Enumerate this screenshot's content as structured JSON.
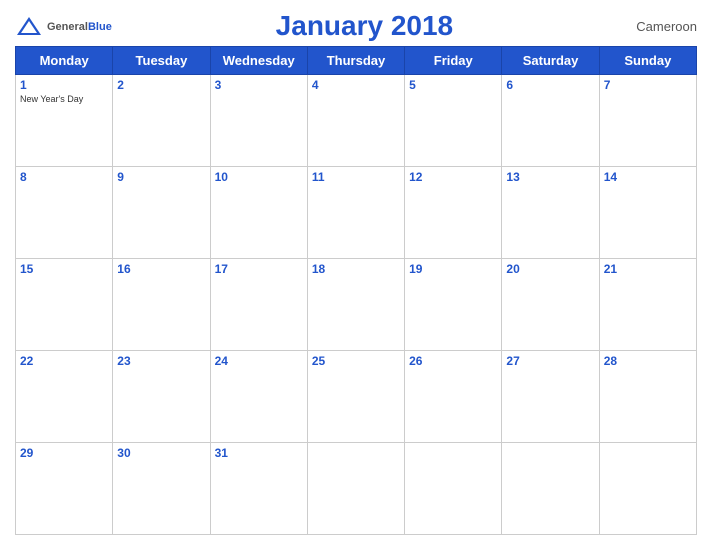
{
  "header": {
    "logo_general": "General",
    "logo_blue": "Blue",
    "title": "January 2018",
    "country": "Cameroon"
  },
  "weekdays": [
    "Monday",
    "Tuesday",
    "Wednesday",
    "Thursday",
    "Friday",
    "Saturday",
    "Sunday"
  ],
  "weeks": [
    [
      {
        "day": "1",
        "holiday": "New Year's Day"
      },
      {
        "day": "2",
        "holiday": ""
      },
      {
        "day": "3",
        "holiday": ""
      },
      {
        "day": "4",
        "holiday": ""
      },
      {
        "day": "5",
        "holiday": ""
      },
      {
        "day": "6",
        "holiday": ""
      },
      {
        "day": "7",
        "holiday": ""
      }
    ],
    [
      {
        "day": "8",
        "holiday": ""
      },
      {
        "day": "9",
        "holiday": ""
      },
      {
        "day": "10",
        "holiday": ""
      },
      {
        "day": "11",
        "holiday": ""
      },
      {
        "day": "12",
        "holiday": ""
      },
      {
        "day": "13",
        "holiday": ""
      },
      {
        "day": "14",
        "holiday": ""
      }
    ],
    [
      {
        "day": "15",
        "holiday": ""
      },
      {
        "day": "16",
        "holiday": ""
      },
      {
        "day": "17",
        "holiday": ""
      },
      {
        "day": "18",
        "holiday": ""
      },
      {
        "day": "19",
        "holiday": ""
      },
      {
        "day": "20",
        "holiday": ""
      },
      {
        "day": "21",
        "holiday": ""
      }
    ],
    [
      {
        "day": "22",
        "holiday": ""
      },
      {
        "day": "23",
        "holiday": ""
      },
      {
        "day": "24",
        "holiday": ""
      },
      {
        "day": "25",
        "holiday": ""
      },
      {
        "day": "26",
        "holiday": ""
      },
      {
        "day": "27",
        "holiday": ""
      },
      {
        "day": "28",
        "holiday": ""
      }
    ],
    [
      {
        "day": "29",
        "holiday": ""
      },
      {
        "day": "30",
        "holiday": ""
      },
      {
        "day": "31",
        "holiday": ""
      },
      {
        "day": "",
        "holiday": ""
      },
      {
        "day": "",
        "holiday": ""
      },
      {
        "day": "",
        "holiday": ""
      },
      {
        "day": "",
        "holiday": ""
      }
    ]
  ]
}
